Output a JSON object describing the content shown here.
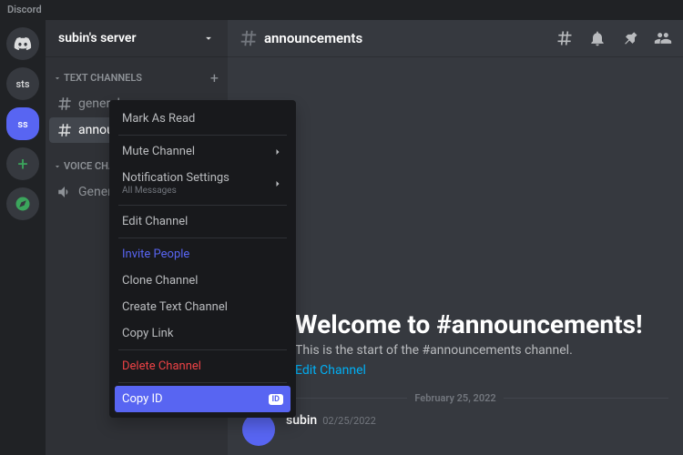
{
  "titlebar": "Discord",
  "rail": {
    "sts": "sts",
    "ss": "ss"
  },
  "server": {
    "name": "subin's server"
  },
  "categories": {
    "text": "TEXT CHANNELS",
    "voice": "VOICE CHANNELS"
  },
  "channels": {
    "general": "general",
    "announcements": "announcements",
    "voice_general": "General"
  },
  "header": {
    "title": "announcements"
  },
  "welcome": {
    "title": "Welcome to #announcements!",
    "subtitle": "This is the start of the #announcements channel.",
    "edit": "Edit Channel"
  },
  "divider_date": "February 25, 2022",
  "message": {
    "user": "subin",
    "ts": "02/25/2022"
  },
  "menu": {
    "mark_read": "Mark As Read",
    "mute": "Mute Channel",
    "notif": "Notification Settings",
    "notif_sub": "All Messages",
    "edit": "Edit Channel",
    "invite": "Invite People",
    "clone": "Clone Channel",
    "create": "Create Text Channel",
    "copy_link": "Copy Link",
    "delete": "Delete Channel",
    "copy_id": "Copy ID",
    "id_badge": "ID"
  }
}
